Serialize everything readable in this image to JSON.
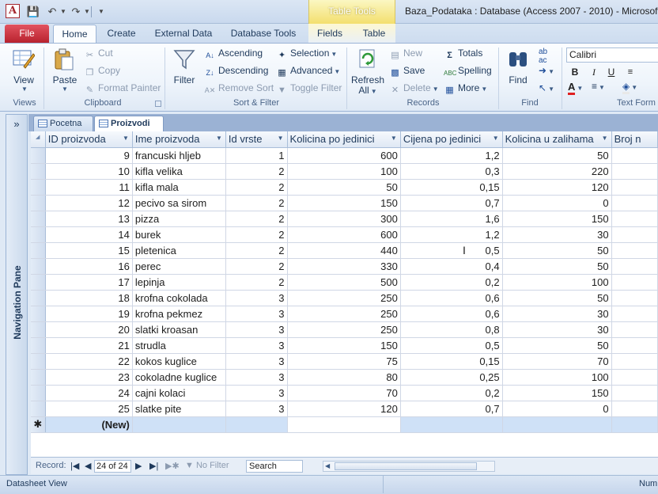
{
  "window_title": "Baza_Podataka : Database (Access 2007 - 2010)  -  Microsoft A",
  "context_header": "Table Tools",
  "tabs": [
    "File",
    "Home",
    "Create",
    "External Data",
    "Database Tools",
    "Fields",
    "Table"
  ],
  "ribbon": {
    "views": {
      "view": "View",
      "label": "Views"
    },
    "clipboard": {
      "paste": "Paste",
      "cut": "Cut",
      "copy": "Copy",
      "format_painter": "Format Painter",
      "label": "Clipboard"
    },
    "sort_filter": {
      "filter": "Filter",
      "ascending": "Ascending",
      "descending": "Descending",
      "remove_sort": "Remove Sort",
      "selection": "Selection",
      "advanced": "Advanced",
      "toggle_filter": "Toggle Filter",
      "label": "Sort & Filter"
    },
    "records": {
      "refresh": "Refresh",
      "refresh2": "All",
      "new": "New",
      "save": "Save",
      "delete": "Delete",
      "totals": "Totals",
      "spelling": "Spelling",
      "more": "More",
      "label": "Records"
    },
    "find": {
      "find": "Find",
      "label": "Find"
    },
    "text_format": {
      "font": "Calibri",
      "bold": "B",
      "italic": "I",
      "underline": "U",
      "label": "Text Form"
    }
  },
  "nav_pane": {
    "toggle": "»",
    "label": "Navigation Pane"
  },
  "doc_tabs": [
    "Pocetna",
    "Proizvodi"
  ],
  "columns": [
    "ID proizvoda",
    "Ime proizvoda",
    "Id vrste",
    "Kolicina po jedinici",
    "Cijena po jedinici",
    "Kolicina u zalihama",
    "Broj n"
  ],
  "rows": [
    [
      "9",
      "francuski hljeb",
      "1",
      "600",
      "1,2",
      "50"
    ],
    [
      "10",
      "kifla velika",
      "2",
      "100",
      "0,3",
      "220"
    ],
    [
      "11",
      "kifla mala",
      "2",
      "50",
      "0,15",
      "120"
    ],
    [
      "12",
      "pecivo sa sirom",
      "2",
      "150",
      "0,7",
      "0"
    ],
    [
      "13",
      "pizza",
      "2",
      "300",
      "1,6",
      "150"
    ],
    [
      "14",
      "burek",
      "2",
      "600",
      "1,2",
      "30"
    ],
    [
      "15",
      "pletenica",
      "2",
      "440",
      "0,5",
      "50"
    ],
    [
      "16",
      "perec",
      "2",
      "330",
      "0,4",
      "50"
    ],
    [
      "17",
      "lepinja",
      "2",
      "500",
      "0,2",
      "100"
    ],
    [
      "18",
      "krofna cokolada",
      "3",
      "250",
      "0,6",
      "50"
    ],
    [
      "19",
      "krofna pekmez",
      "3",
      "250",
      "0,6",
      "30"
    ],
    [
      "20",
      "slatki kroasan",
      "3",
      "250",
      "0,8",
      "30"
    ],
    [
      "21",
      "strudla",
      "3",
      "150",
      "0,5",
      "50"
    ],
    [
      "22",
      "kokos kuglice",
      "3",
      "75",
      "0,15",
      "70"
    ],
    [
      "23",
      "cokoladne kuglice",
      "3",
      "80",
      "0,25",
      "100"
    ],
    [
      "24",
      "cajni kolaci",
      "3",
      "70",
      "0,2",
      "150"
    ],
    [
      "25",
      "slatke pite",
      "3",
      "120",
      "0,7",
      "0"
    ]
  ],
  "new_row": "(New)",
  "record_nav": {
    "label": "Record:",
    "position": "24 of 24",
    "no_filter": "No Filter",
    "search": "Search"
  },
  "status": {
    "left": "Datasheet View",
    "right": "Num"
  }
}
